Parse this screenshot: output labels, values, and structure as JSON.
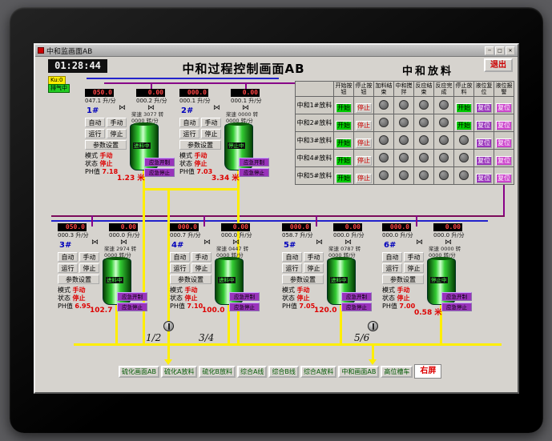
{
  "window": {
    "title": "中和监画面AB",
    "minimize": "─",
    "maximize": "□",
    "close": "✕"
  },
  "header": {
    "time": "01:28:44",
    "title": "中和过程控制画面AB",
    "exit": "退出",
    "tag_yellow": "Ku:0",
    "tag_green": "排气中"
  },
  "release_table": {
    "title": "中和放料",
    "headers": [
      "开始按钮",
      "停止按钮",
      "加料结束",
      "中和搅拌",
      "反应结束",
      "反应完成",
      "停止放料",
      "液位复位",
      "液位报警"
    ],
    "start_label": "开始",
    "stop_label": "停止",
    "reset_label": "复位",
    "rows": [
      {
        "label": "中和1#放料",
        "has_mid_start": true
      },
      {
        "label": "中和2#放料",
        "has_mid_start": true
      },
      {
        "label": "中和3#放料",
        "has_mid_start": false
      },
      {
        "label": "中和4#放料",
        "has_mid_start": false
      },
      {
        "label": "中和5#放料",
        "has_mid_start": false
      }
    ]
  },
  "unit_labels": {
    "auto": "自动",
    "manual": "手动",
    "run": "运行",
    "stop": "停止",
    "param": "参数设置",
    "mode": "模式",
    "state": "状态",
    "ph": "PH值",
    "emg_open": "应急开制",
    "emg_stop": "应急停止",
    "flow_unit": "升/分"
  },
  "units": [
    {
      "id": "1#",
      "flow_set_l": "050.0",
      "flow_act_l": "047.1",
      "flow_set_r": "0.00",
      "flow_act_r": "000.2",
      "speed": "桨速 3077 转",
      "speed_set": "0000 转/分",
      "mode": "手动",
      "state": "停止",
      "ph": "7.18",
      "tank_status": "进料中",
      "level": "1.23 米"
    },
    {
      "id": "2#",
      "flow_set_l": "000.0",
      "flow_act_l": "000.1",
      "flow_set_r": "0.00",
      "flow_act_r": "000.1",
      "speed": "桨速 0000 转",
      "speed_set": "0000 转/分",
      "mode": "手动",
      "state": "停止",
      "ph": "7.03",
      "tank_status": "停止中",
      "level": "3.34 米"
    },
    {
      "id": "3#",
      "flow_set_l": "050.0",
      "flow_act_l": "000.3",
      "flow_set_r": "0.00",
      "flow_act_r": "000.0",
      "speed": "桨速 2974 转",
      "speed_set": "0000 转/分",
      "mode": "手动",
      "state": "停止",
      "ph": "6.95",
      "tank_status": "进料中",
      "level": "102.7"
    },
    {
      "id": "4#",
      "flow_set_l": "000.0",
      "flow_act_l": "000.7",
      "flow_set_r": "0.00",
      "flow_act_r": "000.0",
      "speed": "桨速 0447 转",
      "speed_set": "0000 转/分",
      "mode": "手动",
      "state": "停止",
      "ph": "7.10",
      "tank_status": "进料中",
      "level": "100.0"
    },
    {
      "id": "5#",
      "flow_set_l": "000.0",
      "flow_act_l": "058.7",
      "flow_set_r": "0.00",
      "flow_act_r": "000.0",
      "speed": "桨速 0787 转",
      "speed_set": "0000 转/分",
      "mode": "手动",
      "state": "停止",
      "ph": "7.05",
      "tank_status": "进料中",
      "level": "120.0"
    },
    {
      "id": "6#",
      "flow_set_l": "000.0",
      "flow_act_l": "000.0",
      "flow_set_r": "0.00",
      "flow_act_r": "000.0",
      "speed": "桨速 0000 转",
      "speed_set": "0000 转/分",
      "mode": "手动",
      "state": "停止",
      "ph": "7.00",
      "tank_status": "停止中",
      "level": "0.58 米"
    }
  ],
  "pumps": {
    "labels": [
      "1/2",
      "3/4",
      "5/6"
    ]
  },
  "footer": {
    "buttons": [
      "硫化画面AB",
      "硫化A放料",
      "硫化B放料",
      "综合A线",
      "综合B线",
      "综合A放料",
      "中和画面AB",
      "高位槽车"
    ],
    "right_screen": "右屏"
  },
  "colors": {
    "start_green": "#00cc00",
    "stop_red": "#dd0000",
    "purple_btn": "#9933bb",
    "magenta_btn": "#cc44cc",
    "pipe_yellow": "#ffee00",
    "pipe_purple": "#880088",
    "pipe_blue": "#2222cc"
  }
}
